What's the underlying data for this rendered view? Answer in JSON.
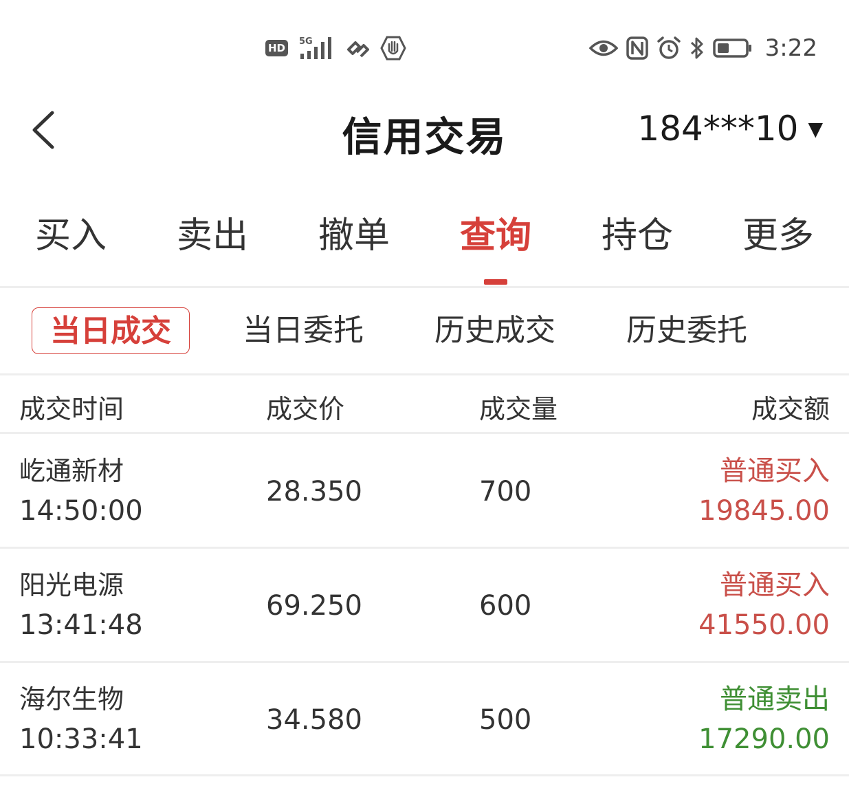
{
  "status_bar": {
    "hd_label": "HD",
    "net_label": "5G",
    "time": "3:22",
    "icons_left": [
      "hd-icon",
      "signal-icon",
      "link-icon",
      "hand-icon"
    ],
    "icons_right": [
      "eye-icon",
      "nfc-icon",
      "alarm-icon",
      "bluetooth-icon",
      "battery-icon"
    ]
  },
  "header": {
    "title": "信用交易",
    "account": "184***10",
    "caret": "▼"
  },
  "main_tabs": [
    {
      "label": "买入"
    },
    {
      "label": "卖出"
    },
    {
      "label": "撤单"
    },
    {
      "label": "查询",
      "active": true
    },
    {
      "label": "持仓"
    },
    {
      "label": "更多"
    }
  ],
  "sub_tabs": [
    {
      "label": "当日成交",
      "active": true
    },
    {
      "label": "当日委托"
    },
    {
      "label": "历史成交"
    },
    {
      "label": "历史委托"
    }
  ],
  "table": {
    "headers": [
      "成交时间",
      "成交价",
      "成交量",
      "成交额"
    ],
    "rows": [
      {
        "name": "屹通新材",
        "time": "14:50:00",
        "price": "28.350",
        "qty": "700",
        "type": "普通买入",
        "amount": "19845.00",
        "direction": "buy"
      },
      {
        "name": "阳光电源",
        "time": "13:41:48",
        "price": "69.250",
        "qty": "600",
        "type": "普通买入",
        "amount": "41550.00",
        "direction": "buy"
      },
      {
        "name": "海尔生物",
        "time": "10:33:41",
        "price": "34.580",
        "qty": "500",
        "type": "普通卖出",
        "amount": "17290.00",
        "direction": "sell"
      }
    ]
  },
  "colors": {
    "accent_red": "#d6403a",
    "buy_red": "#c9504a",
    "sell_green": "#3f8f34"
  }
}
